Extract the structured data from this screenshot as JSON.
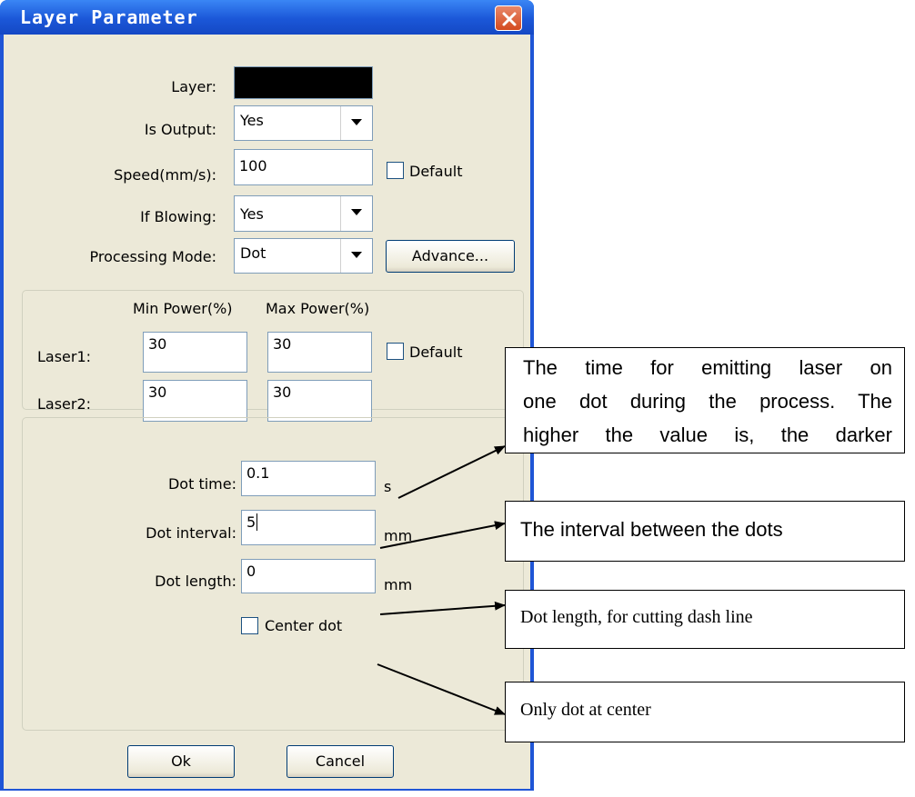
{
  "window": {
    "title": "Layer Parameter",
    "close_icon": "close-icon"
  },
  "params": {
    "layer_label": "Layer:",
    "layer_color": "#000000",
    "is_output_label": "Is Output:",
    "is_output_value": "Yes",
    "speed_label": "Speed(mm/s):",
    "speed_value": "100",
    "speed_default_label": "Default",
    "if_blowing_label": "If Blowing:",
    "if_blowing_value": "Yes",
    "processing_mode_label": "Processing Mode:",
    "processing_mode_value": "Dot",
    "advance_label": "Advance..."
  },
  "power": {
    "min_header": "Min Power(%)",
    "max_header": "Max Power(%)",
    "laser1_label": "Laser1:",
    "laser1_min": "30",
    "laser1_max": "30",
    "laser2_label": "Laser2:",
    "laser2_min": "30",
    "laser2_max": "30",
    "default_label": "Default"
  },
  "dot": {
    "time_label": "Dot time:",
    "time_value": "0.1",
    "time_unit": "s",
    "interval_label": "Dot interval:",
    "interval_value": "5",
    "interval_unit": "mm",
    "length_label": "Dot length:",
    "length_value": "0",
    "length_unit": "mm",
    "center_label": "Center dot"
  },
  "buttons": {
    "ok": "Ok",
    "cancel": "Cancel"
  },
  "annotations": {
    "dot_time_line1": "The time for emitting laser on",
    "dot_time_line2": "one dot during the process. The",
    "dot_time_line3": "higher the value is, the darker",
    "dot_interval": "The interval between the dots",
    "dot_length": "Dot length, for cutting dash line",
    "center_dot": "Only dot at center"
  }
}
